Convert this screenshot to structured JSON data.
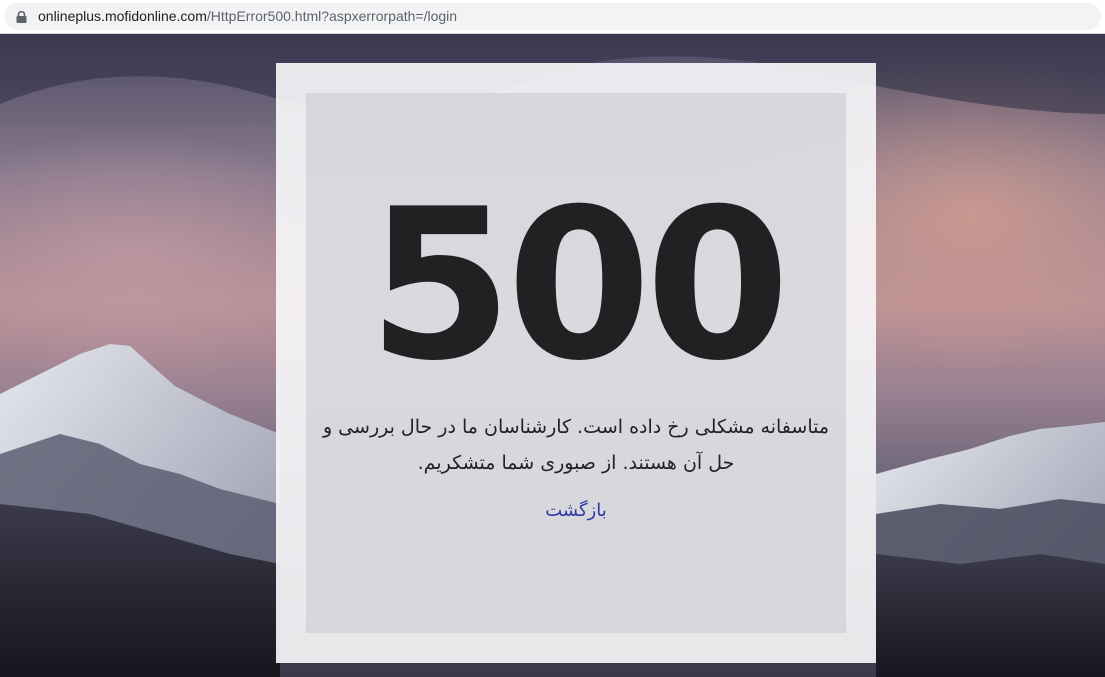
{
  "browser": {
    "lock_icon": "lock-icon",
    "url_host": "onlineplus.mofidonline.com",
    "url_path": "/HttpError500.html?aspxerrorpath=/login"
  },
  "error_page": {
    "code": "500",
    "message": "متاسفانه مشکلی رخ داده است. کارشناسان ما در حال بررسی و حل آن هستند. از صبوری شما متشکریم.",
    "back_label": "بازگشت"
  },
  "colors": {
    "code_text": "#212124",
    "link": "#2c3aa8",
    "card": "#f6f6f9"
  }
}
